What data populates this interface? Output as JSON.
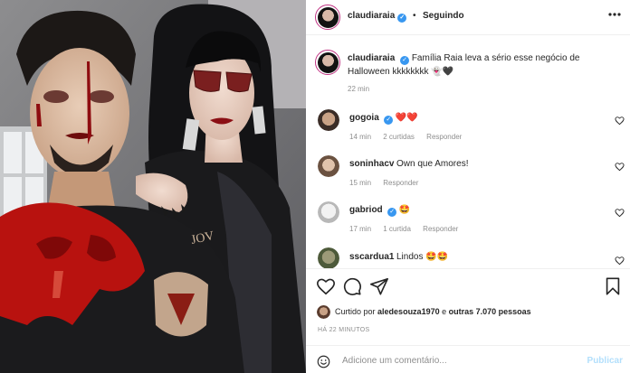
{
  "post": {
    "author": "claudiaraia",
    "follow_separator": "•",
    "follow_label": "Seguindo",
    "verified_glyph": "✓"
  },
  "caption": {
    "user": "claudiaraia",
    "text": "Família Raia leva a sério esse negócio de Halloween kkkkkkkk",
    "emoji": "👻🖤",
    "time": "22 min"
  },
  "comments": [
    {
      "user": "gogoia",
      "text": "❤️❤️",
      "time": "14 min",
      "likes": "2 curtidas",
      "reply": "Responder",
      "verified": true
    },
    {
      "user": "soninhacv",
      "text": "Own que Amores!",
      "time": "15 min",
      "likes": "",
      "reply": "Responder",
      "verified": false
    },
    {
      "user": "gabriod",
      "text": "🤩",
      "time": "17 min",
      "likes": "1 curtida",
      "reply": "Responder",
      "verified": true
    },
    {
      "user": "sscardua1",
      "text": "Lindos 🤩🤩",
      "time": "",
      "likes": "",
      "reply": "",
      "verified": false
    }
  ],
  "likes": {
    "prefix": "Curtido por",
    "user": "aledesouza1970",
    "middle": "e",
    "others": "outras 7.070 pessoas"
  },
  "timestamp": "HÁ 22 MINUTOS",
  "add_comment": {
    "placeholder": "Adicione um comentário...",
    "publish_label": "Publicar",
    "emoji_icon": "smiley-icon"
  },
  "colors": {
    "link_blue": "#3897f0",
    "muted": "#8e8e8e",
    "heart_red": "#ed4956",
    "ring": "#c13584"
  }
}
